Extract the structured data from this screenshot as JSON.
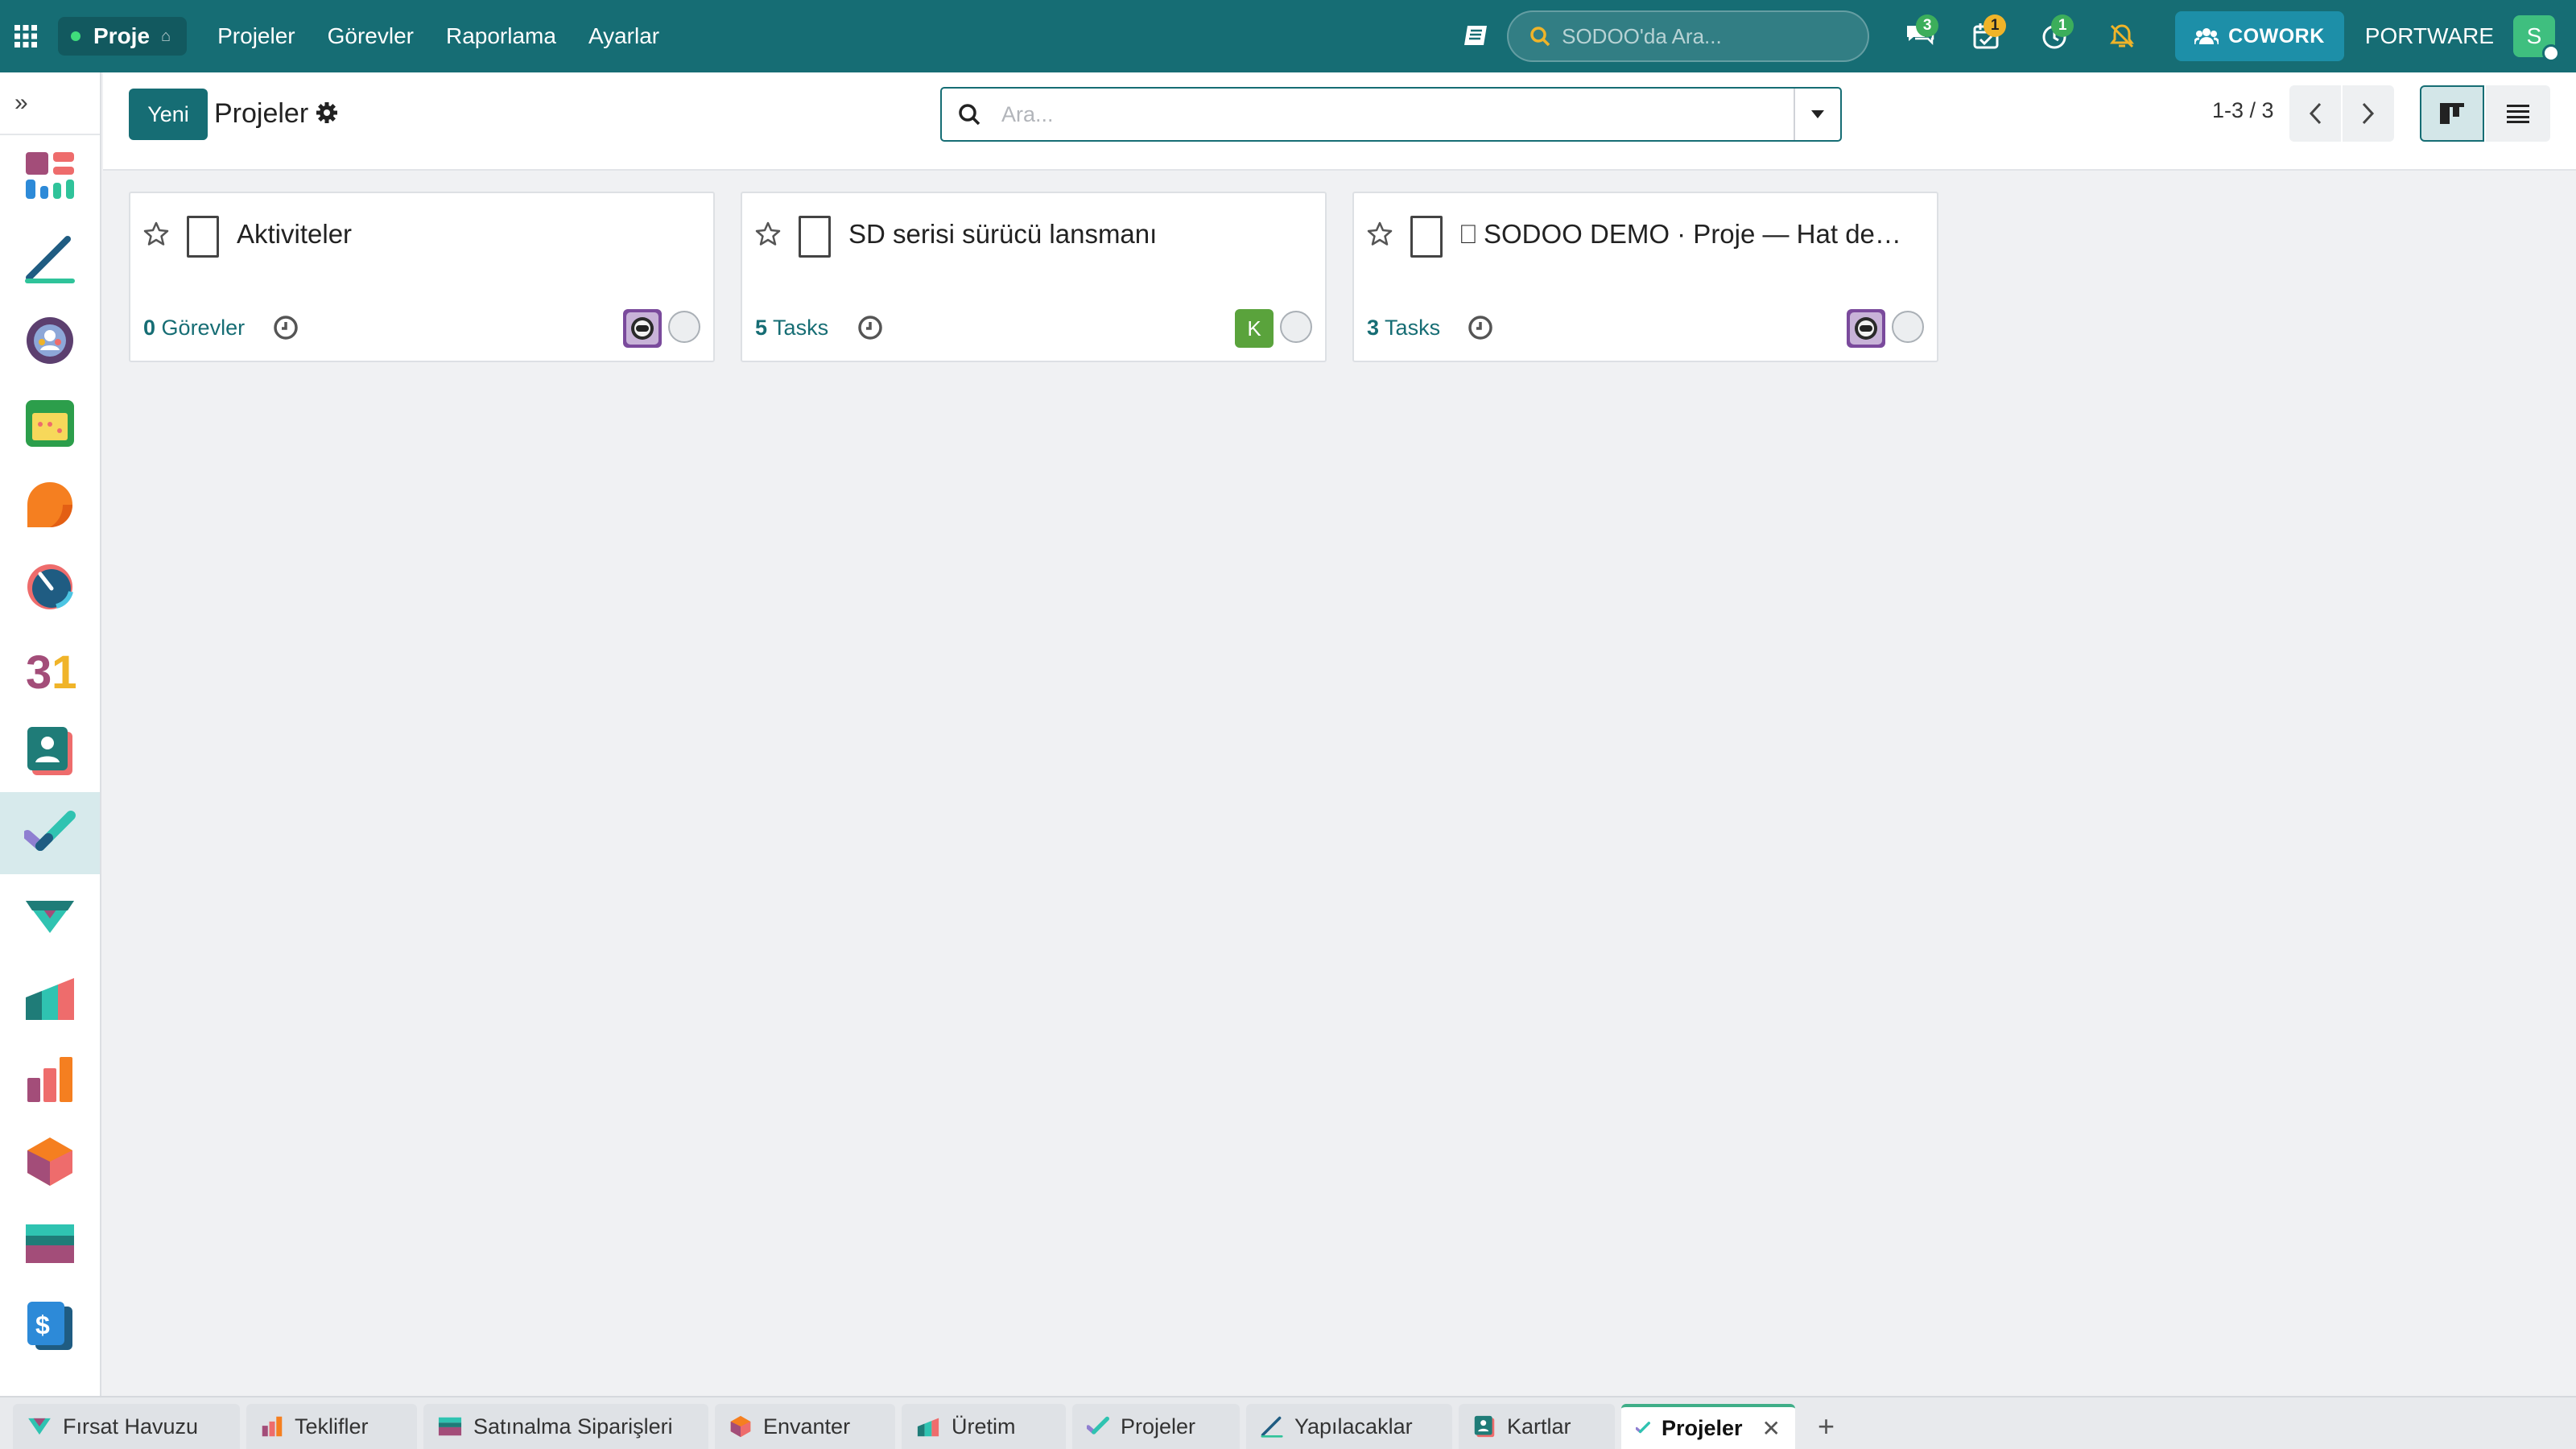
{
  "navbar": {
    "app_name": "Proje",
    "menu": [
      "Projeler",
      "Görevler",
      "Raporlama",
      "Ayarlar"
    ],
    "search_placeholder": "SODOO'da Ara...",
    "badges": {
      "messages": "3",
      "activities": "1",
      "timer": "1"
    },
    "cowork_label": "COWORK",
    "company": "PORTWARE",
    "user_initial": "S"
  },
  "sidebar": {
    "collapse_glyph": "»",
    "apps": [
      "dashboard-icon",
      "todo-icon",
      "discuss-icon",
      "calendar-icon",
      "crm-icon",
      "timesheet-icon",
      "calendar31-icon",
      "contacts-icon",
      "project-icon",
      "crm-pipeline-icon",
      "manufacturing-icon",
      "sales-icon",
      "inventory-icon",
      "purchase-icon",
      "invoicing-icon"
    ],
    "active_index": 8
  },
  "control": {
    "new_label": "Yeni",
    "title": "Projeler",
    "search_placeholder": "Ara...",
    "pager": "1-3 / 3"
  },
  "cards": [
    {
      "name": "Aktiviteler",
      "task_count": "0",
      "task_label": "Görevler",
      "owner": "robot"
    },
    {
      "name": "SD serisi sürücü lansmanı",
      "task_count": "5",
      "task_label": "Tasks",
      "owner": "K"
    },
    {
      "name": "⎕ SODOO DEMO · Proje — Hat devreye alma",
      "task_count": "3",
      "task_label": "Tasks",
      "owner": "robot"
    }
  ],
  "tabs": [
    {
      "label": "Fırsat Havuzu",
      "icon": "crm-pipeline-icon"
    },
    {
      "label": "Teklifler",
      "icon": "sales-icon"
    },
    {
      "label": "Satınalma Siparişleri",
      "icon": "purchase-icon"
    },
    {
      "label": "Envanter",
      "icon": "inventory-icon"
    },
    {
      "label": "Üretim",
      "icon": "manufacturing-icon"
    },
    {
      "label": "Projeler",
      "icon": "project-icon"
    },
    {
      "label": "Yapılacaklar",
      "icon": "todo-icon"
    },
    {
      "label": "Kartlar",
      "icon": "contacts-icon"
    },
    {
      "label": "Projeler",
      "icon": "project-icon"
    }
  ],
  "colors": {
    "brand": "#166d74",
    "owner_k": "#5aa33c"
  }
}
